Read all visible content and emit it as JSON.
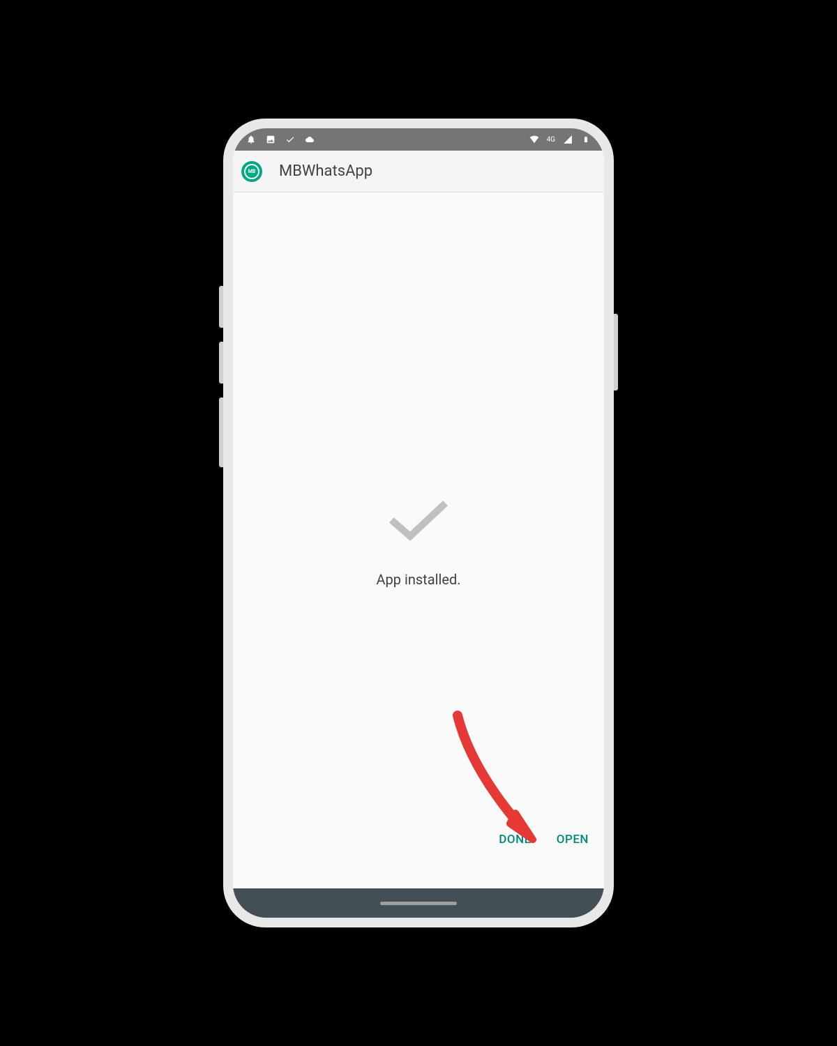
{
  "header": {
    "app_name": "MBWhatsApp",
    "icon_label": "MB"
  },
  "content": {
    "status_message": "App installed."
  },
  "actions": {
    "done_label": "DONE",
    "open_label": "OPEN"
  },
  "colors": {
    "accent": "#00897b",
    "icon_green": "#00a884",
    "arrow_red": "#e53935"
  }
}
